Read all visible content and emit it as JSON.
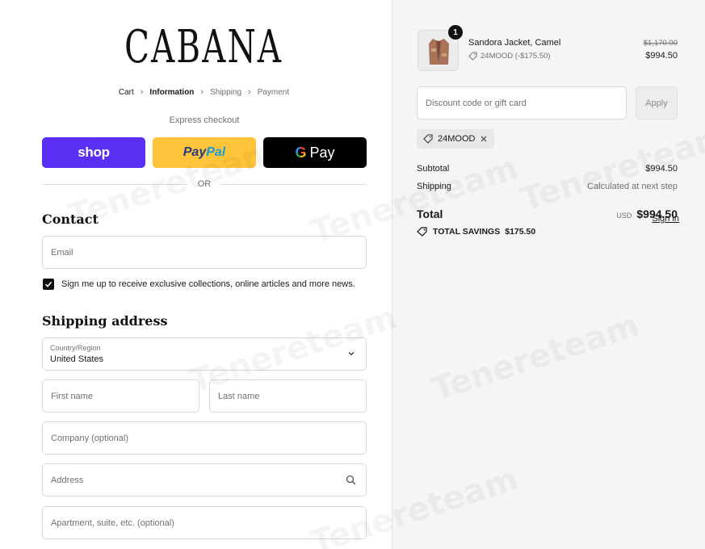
{
  "brand": {
    "logo": "CABANA"
  },
  "breadcrumb": {
    "items": [
      {
        "label": "Cart",
        "state": "link"
      },
      {
        "label": "Information",
        "state": "active"
      },
      {
        "label": "Shipping",
        "state": "upcoming"
      },
      {
        "label": "Payment",
        "state": "upcoming"
      }
    ]
  },
  "express": {
    "label": "Express checkout",
    "shop_label": "shop",
    "paypal_1": "Pay",
    "paypal_2": "Pal",
    "gpay_g": "G",
    "gpay_label": "Pay",
    "or_label": "OR"
  },
  "contact": {
    "title": "Contact",
    "signin": "Sign in",
    "email_placeholder": "Email",
    "newsletter_label": "Sign me up to receive exclusive collections, online articles and more news.",
    "newsletter_checked": true
  },
  "shipping": {
    "title": "Shipping address",
    "country_label": "Country/Region",
    "country_value": "United States",
    "first_name": "First name",
    "last_name": "Last name",
    "company": "Company (optional)",
    "address": "Address",
    "apartment": "Apartment, suite, etc. (optional)"
  },
  "order": {
    "product": {
      "name": "Sandora Jacket, Camel",
      "quantity": "1",
      "discount": "24MOOD (-$175.50)",
      "original_price": "$1,170.00",
      "price": "$994.50"
    },
    "discount_placeholder": "Discount code or gift card",
    "apply_label": "Apply",
    "applied_code": "24MOOD",
    "subtotal_label": "Subtotal",
    "subtotal_value": "$994.50",
    "shipping_label": "Shipping",
    "shipping_value": "Calculated at next step",
    "total_label": "Total",
    "currency": "USD",
    "total_value": "$994.50",
    "savings_label": "TOTAL SAVINGS",
    "savings_value": "$175.50"
  },
  "watermark": "Tenereteam",
  "colors": {
    "shop": "#5a31f4",
    "paypal": "#ffc439",
    "gpay": "#000000",
    "sidebar_bg": "#f5f5f5"
  }
}
